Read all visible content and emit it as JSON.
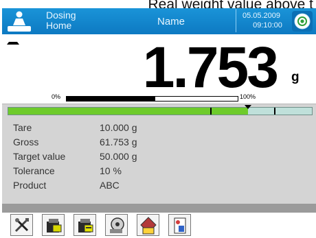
{
  "caption": "Real weight value above t",
  "header": {
    "mode_line1": "Dosing",
    "mode_line2": "Home",
    "title": "Name",
    "date": "05.05.2009",
    "time": "09:10:00"
  },
  "weighing": {
    "value": "1.753",
    "unit": "g",
    "range_min": "0%",
    "range_max": "100%",
    "range_fraction": 0.52
  },
  "dosing_bar": {
    "fill_fraction": 0.79,
    "target_fraction": 0.665,
    "marker_fraction": 0.875
  },
  "info": {
    "rows": [
      {
        "label": "Tare",
        "value": "10.000  g"
      },
      {
        "label": "Gross",
        "value": "61.753  g"
      },
      {
        "label": "Target value",
        "value": "50.000  g"
      },
      {
        "label": "Tolerance",
        "value": "10 %"
      },
      {
        "label": "Product",
        "value": "ABC"
      }
    ]
  },
  "toolbar": {
    "buttons": [
      "tools-icon",
      "tare-icon",
      "tare-select-icon",
      "weigh-icon",
      "product-icon",
      "report-icon"
    ]
  },
  "colors": {
    "header": "#1a94d8",
    "bar_fill": "#6ecb2b",
    "panel": "#d4d4d4"
  }
}
